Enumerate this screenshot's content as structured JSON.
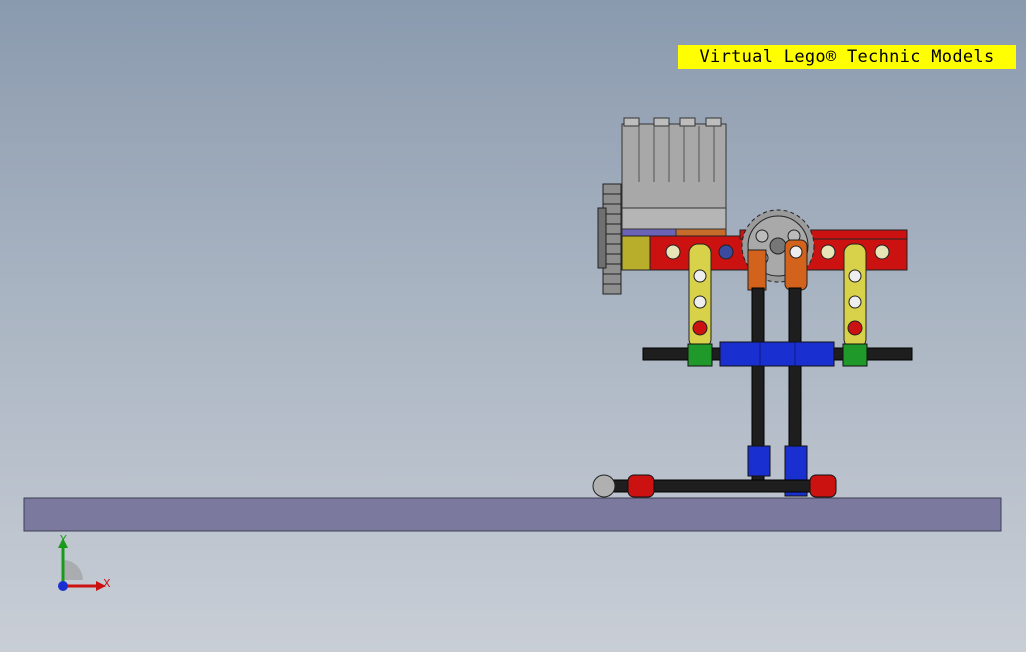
{
  "banner": {
    "text": "Virtual Lego® Technic Models"
  },
  "triad": {
    "y_label": "Y",
    "x_label": "X"
  },
  "colors": {
    "background_top": "#8a9aae",
    "background_bottom": "#c9ced6",
    "banner": "#ffff00",
    "ground_plate": "#7b7a9e",
    "motor_gray": "#a8a8a8",
    "beam_red": "#cc1111",
    "liftarm_yellow": "#d8d24a",
    "axle_black": "#1e1e1e",
    "connector_blue": "#1a2fd0",
    "bush_green": "#1f9a2a",
    "orange": "#d3621c",
    "gear_gray": "#9a9a9a"
  }
}
